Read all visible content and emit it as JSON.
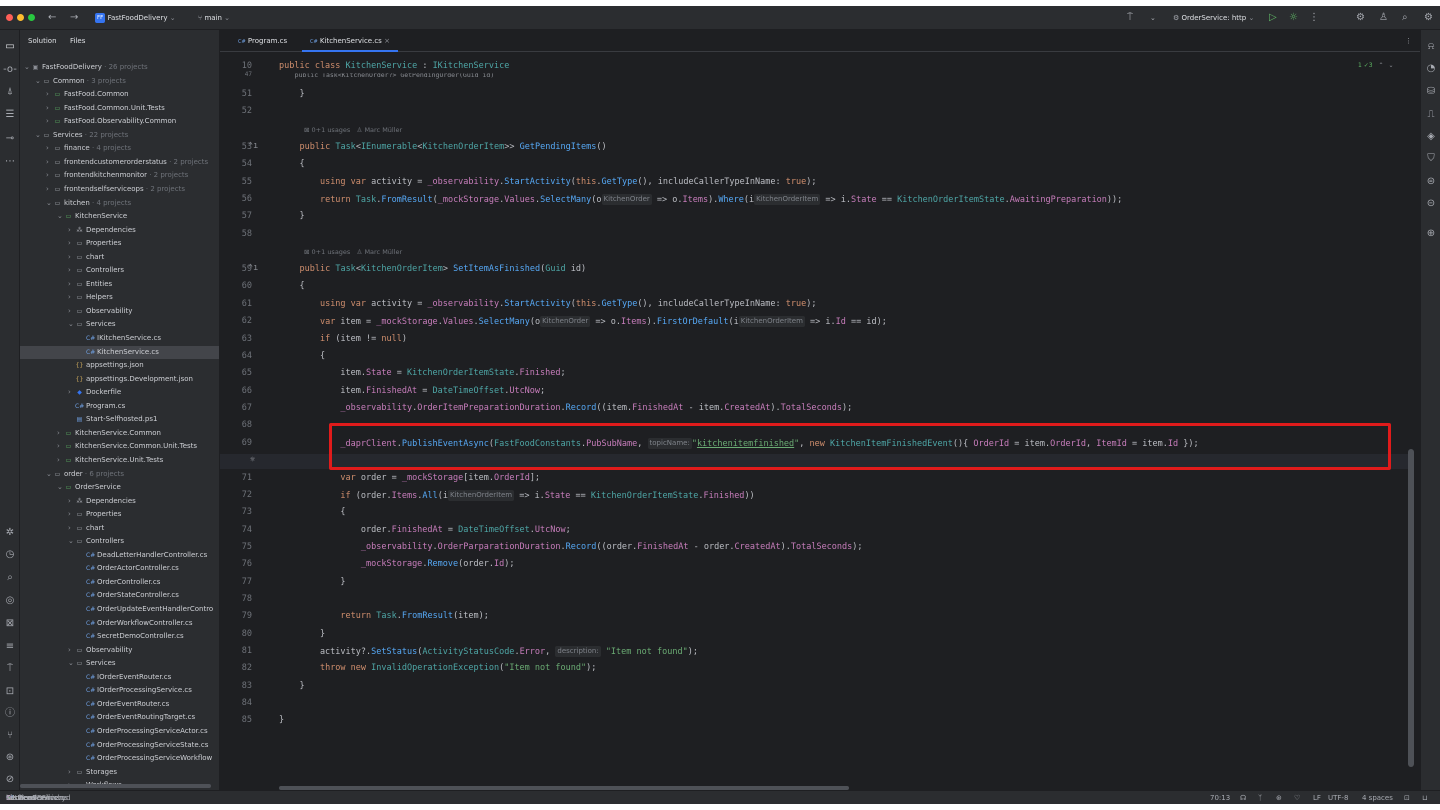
{
  "titlebar": {
    "project_badge": "FF",
    "project_name": "FastFoodDelivery",
    "branch": "main",
    "run_config": "OrderService: http"
  },
  "project_panel": {
    "tabs": [
      "Solution",
      "Files"
    ],
    "rows": [
      {
        "t": "FastFoodDelivery",
        "s": "26 projects",
        "i": "sln",
        "o": "open"
      },
      {
        "t": "Common",
        "s": "3 projects",
        "i": "folder",
        "o": "open"
      },
      {
        "t": "FastFood.Common",
        "s": "",
        "i": "proj",
        "o": "closed"
      },
      {
        "t": "FastFood.Common.Unit.Tests",
        "s": "",
        "i": "proj",
        "o": "closed"
      },
      {
        "t": "FastFood.Observability.Common",
        "s": "",
        "i": "proj",
        "o": "closed"
      },
      {
        "t": "Services",
        "s": "22 projects",
        "i": "folder",
        "o": "open"
      },
      {
        "t": "finance",
        "s": "4 projects",
        "i": "folder",
        "o": "closed"
      },
      {
        "t": "frontendcustomerorderstatus",
        "s": "2 projects",
        "i": "folder",
        "o": "closed"
      },
      {
        "t": "frontendkitchenmonitor",
        "s": "2 projects",
        "i": "folder",
        "o": "closed"
      },
      {
        "t": "frontendselfserviceops",
        "s": "2 projects",
        "i": "folder",
        "o": "closed"
      },
      {
        "t": "kitchen",
        "s": "4 projects",
        "i": "folder",
        "o": "open"
      },
      {
        "t": "KitchenService",
        "s": "",
        "i": "proj",
        "o": "open"
      },
      {
        "t": "Dependencies",
        "s": "",
        "i": "dep",
        "o": "closed"
      },
      {
        "t": "Properties",
        "s": "",
        "i": "folder",
        "o": "closed"
      },
      {
        "t": "chart",
        "s": "",
        "i": "folder",
        "o": "closed"
      },
      {
        "t": "Controllers",
        "s": "",
        "i": "folder",
        "o": "closed"
      },
      {
        "t": "Entities",
        "s": "",
        "i": "folder",
        "o": "closed"
      },
      {
        "t": "Helpers",
        "s": "",
        "i": "folder",
        "o": "closed"
      },
      {
        "t": "Observability",
        "s": "",
        "i": "folder",
        "o": "closed"
      },
      {
        "t": "Services",
        "s": "",
        "i": "folder",
        "o": "open"
      },
      {
        "t": "IKitchenService.cs",
        "s": "",
        "i": "cs",
        "o": "none"
      },
      {
        "t": "KitchenService.cs",
        "s": "",
        "i": "cs",
        "o": "none"
      },
      {
        "t": "appsettings.json",
        "s": "",
        "i": "json",
        "o": "none"
      },
      {
        "t": "appsettings.Development.json",
        "s": "",
        "i": "json",
        "o": "none"
      },
      {
        "t": "Dockerfile",
        "s": "",
        "i": "docker",
        "o": "closed"
      },
      {
        "t": "Program.cs",
        "s": "",
        "i": "cs",
        "o": "none"
      },
      {
        "t": "Start-Selfhosted.ps1",
        "s": "",
        "i": "ps",
        "o": "none"
      },
      {
        "t": "KitchenService.Common",
        "s": "",
        "i": "proj",
        "o": "closed"
      },
      {
        "t": "KitchenService.Common.Unit.Tests",
        "s": "",
        "i": "proj",
        "o": "closed"
      },
      {
        "t": "KitchenService.Unit.Tests",
        "s": "",
        "i": "proj",
        "o": "closed"
      },
      {
        "t": "order",
        "s": "6 projects",
        "i": "folder",
        "o": "open"
      },
      {
        "t": "OrderService",
        "s": "",
        "i": "proj",
        "o": "open"
      },
      {
        "t": "Dependencies",
        "s": "",
        "i": "dep",
        "o": "closed"
      },
      {
        "t": "Properties",
        "s": "",
        "i": "folder",
        "o": "closed"
      },
      {
        "t": "chart",
        "s": "",
        "i": "folder",
        "o": "closed"
      },
      {
        "t": "Controllers",
        "s": "",
        "i": "folder",
        "o": "open"
      },
      {
        "t": "DeadLetterHandlerController.cs",
        "s": "",
        "i": "cs",
        "o": "none"
      },
      {
        "t": "OrderActorController.cs",
        "s": "",
        "i": "cs",
        "o": "none"
      },
      {
        "t": "OrderController.cs",
        "s": "",
        "i": "cs",
        "o": "none"
      },
      {
        "t": "OrderStateController.cs",
        "s": "",
        "i": "cs",
        "o": "none"
      },
      {
        "t": "OrderUpdateEventHandlerContro",
        "s": "",
        "i": "cs",
        "o": "none"
      },
      {
        "t": "OrderWorkflowController.cs",
        "s": "",
        "i": "cs",
        "o": "none"
      },
      {
        "t": "SecretDemoController.cs",
        "s": "",
        "i": "cs",
        "o": "none"
      },
      {
        "t": "Observability",
        "s": "",
        "i": "folder",
        "o": "closed"
      },
      {
        "t": "Services",
        "s": "",
        "i": "folder",
        "o": "open"
      },
      {
        "t": "IOrderEventRouter.cs",
        "s": "",
        "i": "cs",
        "o": "none"
      },
      {
        "t": "IOrderProcessingService.cs",
        "s": "",
        "i": "cs",
        "o": "none"
      },
      {
        "t": "OrderEventRouter.cs",
        "s": "",
        "i": "cs",
        "o": "none"
      },
      {
        "t": "OrderEventRoutingTarget.cs",
        "s": "",
        "i": "cs",
        "o": "none"
      },
      {
        "t": "OrderProcessingServiceActor.cs",
        "s": "",
        "i": "cs",
        "o": "none"
      },
      {
        "t": "OrderProcessingServiceState.cs",
        "s": "",
        "i": "cs",
        "o": "none"
      },
      {
        "t": "OrderProcessingServiceWorkflow",
        "s": "",
        "i": "cs",
        "o": "none"
      },
      {
        "t": "Storages",
        "s": "",
        "i": "folder",
        "o": "closed"
      },
      {
        "t": "Workflows",
        "s": "",
        "i": "folder",
        "o": "closed"
      }
    ]
  },
  "editor": {
    "tabs": [
      {
        "label": "Program.cs",
        "active": false
      },
      {
        "label": "KitchenService.cs",
        "active": true
      }
    ],
    "inspection": "1 ✓3",
    "sticky_line": "10",
    "sticky_code": "public class KitchenService : IKitchenService",
    "ghost_line": "47",
    "ghost_code": "public Task<KitchenOrder?> GetPendingOrder(Guid id)",
    "usages_label": "0+1 usages",
    "author": "Marc Müller",
    "hint_kitchen_order": "KitchenOrder",
    "hint_kitchen_order_item": "KitchenOrderItem",
    "hint_topic_name": "topicName:",
    "hint_description": "description:",
    "lines": [
      "51",
      "52",
      "53",
      "54",
      "55",
      "56",
      "57",
      "58",
      "59",
      "60",
      "61",
      "62",
      "63",
      "64",
      "65",
      "66",
      "67",
      "68",
      "69",
      "70",
      "71",
      "72",
      "73",
      "74",
      "75",
      "76",
      "77",
      "78",
      "79",
      "80",
      "81",
      "82",
      "83",
      "84",
      "85"
    ]
  },
  "statusbar": {
    "crumbs": [
      "FastFoodDelivery",
      "Services",
      "kitchen",
      "KitchenService",
      "Services",
      "KitchenService.cs",
      "KitchenService",
      "SetItemAsFinished"
    ],
    "position": "70:13",
    "line_sep": "LF",
    "encoding": "UTF-8",
    "indent": "4 spaces"
  }
}
